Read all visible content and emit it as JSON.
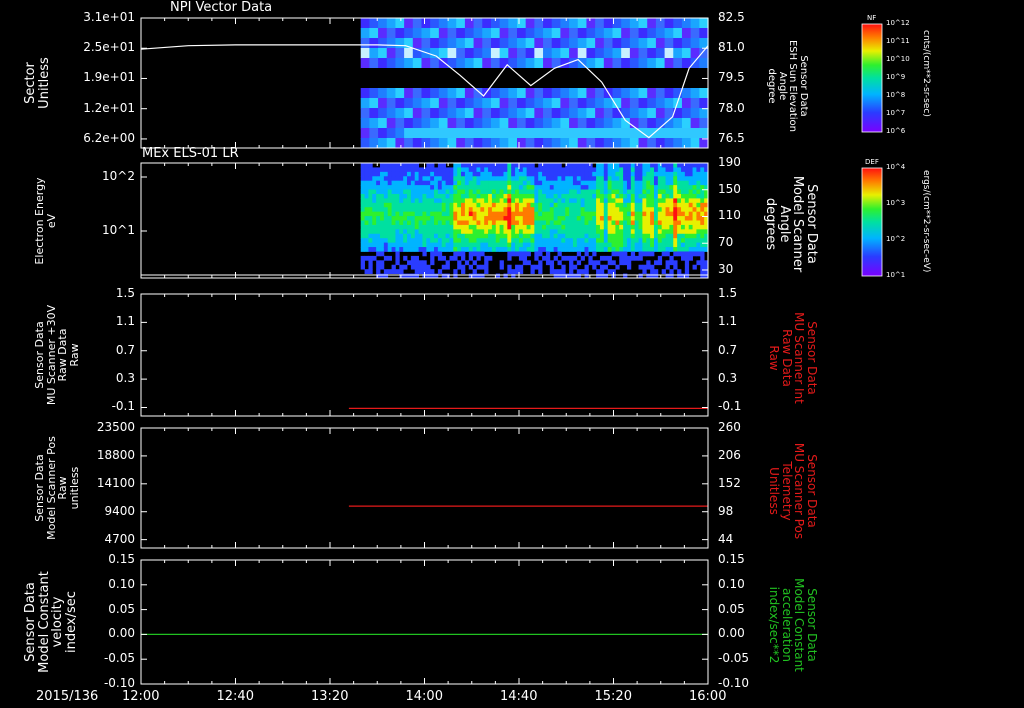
{
  "time_axis": {
    "date_label": "2015/136",
    "ticks": [
      "12:00",
      "12:40",
      "13:20",
      "14:00",
      "14:40",
      "15:20",
      "16:00"
    ],
    "range_minutes": [
      0,
      240
    ],
    "tick_minutes": [
      0,
      40,
      80,
      120,
      160,
      200,
      240
    ]
  },
  "panels": [
    {
      "id": "npi",
      "title": "NPI Vector Data",
      "left_label": [
        "Sector",
        "Unitless"
      ],
      "left_ticks": [
        "3.1e+01",
        "2.5e+01",
        "1.9e+01",
        "1.2e+01",
        "6.2e+00"
      ],
      "right_label": [
        "Sensor Data",
        "ESH Sun Elevation",
        "Angle",
        "degree"
      ],
      "right_ticks": [
        "82.5",
        "81.0",
        "79.5",
        "78.0",
        "76.5"
      ],
      "colorbar": {
        "label": "NF",
        "unit": "cnts/(cm**2-sr-sec)",
        "ticks": [
          "10^12",
          "10^11",
          "10^10",
          "10^9",
          "10^8",
          "10^7",
          "10^6"
        ]
      }
    },
    {
      "id": "els",
      "title": "MEx ELS-01 LR",
      "left_label": [
        "Electron Energy",
        "eV"
      ],
      "left_ticks": [
        "10^2",
        "10^1"
      ],
      "right_label": [
        "Sensor Data",
        "Model Scanner",
        "Angle",
        "degrees"
      ],
      "right_ticks": [
        "190",
        "150",
        "110",
        "70",
        "30"
      ],
      "colorbar": {
        "label": "DEF",
        "unit": "ergs/(cm**2-sr-sec-eV)",
        "ticks": [
          "10^4",
          "10^3",
          "10^2",
          "10^1"
        ]
      }
    },
    {
      "id": "mu_plus",
      "left_label": [
        "Sensor Data",
        "MU Scanner +30V",
        "Raw Data",
        "Raw"
      ],
      "left_ticks": [
        "1.5",
        "1.1",
        "0.7",
        "0.3",
        "-0.1"
      ],
      "right_label": [
        "Sensor Data",
        "MU Scanner Int",
        "Raw Data",
        "Raw"
      ],
      "right_ticks": [
        "1.5",
        "1.1",
        "0.7",
        "0.3",
        "-0.1"
      ]
    },
    {
      "id": "mu_pos",
      "left_label": [
        "Sensor Data",
        "Model Scanner Pos",
        "Raw",
        "unitless"
      ],
      "left_ticks": [
        "23500",
        "18800",
        "14100",
        "9400",
        "4700"
      ],
      "right_label": [
        "Sensor Data",
        "MU Scanner Pos",
        "Telemetry",
        "Unitless"
      ],
      "right_ticks": [
        "260",
        "206",
        "152",
        "98",
        "44"
      ]
    },
    {
      "id": "model_const",
      "left_label": [
        "Sensor Data",
        "Model Constant",
        "velocity",
        "index/sec"
      ],
      "left_ticks": [
        "0.15",
        "0.10",
        "0.05",
        "0.00",
        "-0.05",
        "-0.10"
      ],
      "right_label": [
        "Sensor Data",
        "Model Constant",
        "acceleration",
        "index/sec**2"
      ],
      "right_ticks": [
        "0.15",
        "0.10",
        "0.05",
        "0.00",
        "-0.05",
        "-0.10"
      ]
    }
  ],
  "chart_data": [
    {
      "type": "heatmap",
      "title": "NPI Vector Data",
      "ylabel": "Sector Unitless",
      "ylim": [
        0,
        31
      ],
      "data_start_min": 93,
      "overlay_series": {
        "name": "ESH Sun Elevation Angle",
        "axis": "right",
        "ylim": [
          75.0,
          82.5
        ],
        "x_min": [
          0,
          20,
          40,
          60,
          80,
          100,
          112,
          125,
          135,
          145,
          155,
          165,
          175,
          185,
          195,
          205,
          215,
          225,
          232,
          240
        ],
        "y": [
          80.7,
          80.9,
          80.95,
          80.95,
          80.95,
          80.95,
          80.9,
          80.3,
          79.2,
          78.0,
          79.8,
          78.6,
          79.6,
          80.1,
          78.8,
          76.6,
          75.6,
          76.8,
          79.6,
          80.9
        ]
      },
      "colorbar": {
        "label": "NF",
        "scale": "log",
        "range": [
          1000000.0,
          1000000000000.0
        ]
      }
    },
    {
      "type": "heatmap",
      "title": "MEx ELS-01 LR",
      "ylabel": "Electron Energy eV",
      "yscale": "log",
      "data_start_min": 93,
      "bursts_min": [
        133,
        155,
        193,
        198,
        202,
        207,
        212,
        215,
        220,
        225
      ],
      "overlay_series": {
        "name": "Model Scanner Angle",
        "axis": "right",
        "ylim": [
          0,
          190
        ],
        "x_min": [
          0,
          240
        ],
        "y": [
          5,
          5
        ]
      },
      "colorbar": {
        "label": "DEF",
        "scale": "log",
        "range": [
          10.0,
          10000.0
        ]
      }
    },
    {
      "type": "line",
      "ylim": [
        -0.1,
        1.5
      ],
      "series": [
        {
          "name": "MU Scanner Int Raw Data",
          "color": "#e51a1a",
          "x_min": [
            88,
            240
          ],
          "y": [
            0.0,
            0.0
          ]
        }
      ]
    },
    {
      "type": "line",
      "ylim": [
        0,
        23500
      ],
      "series": [
        {
          "name": "MU Scanner Pos Telemetry",
          "color": "#e51a1a",
          "x_min": [
            88,
            240
          ],
          "y": [
            8200,
            8200
          ]
        }
      ]
    },
    {
      "type": "line",
      "ylim": [
        -0.1,
        0.15
      ],
      "series": [
        {
          "name": "Model Constant velocity",
          "color": "#21c121",
          "x_min": [
            0,
            240
          ],
          "y": [
            0.0,
            0.0
          ]
        }
      ]
    }
  ],
  "colors": {
    "foreground": "#ffffff",
    "red_axis": "#e51a1a",
    "green_axis": "#21c121",
    "background": "#000000"
  }
}
